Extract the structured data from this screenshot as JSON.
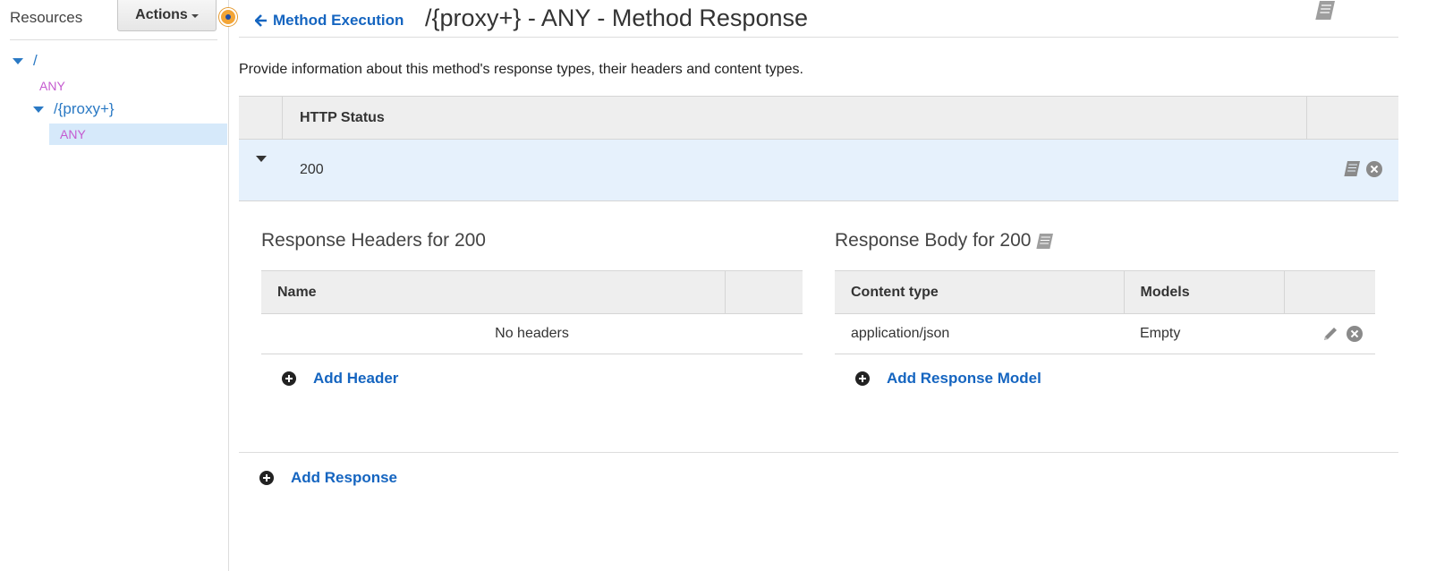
{
  "sidebar": {
    "title": "Resources",
    "actions_label": "Actions",
    "tree": [
      {
        "path": "/",
        "method": "ANY"
      },
      {
        "path": "/{proxy+}",
        "method": "ANY",
        "selected": true
      }
    ]
  },
  "header": {
    "back_label": "Method Execution",
    "title": "/{proxy+} - ANY - Method Response"
  },
  "description": "Provide information about this method's response types, their headers and content types.",
  "status_table": {
    "column_header": "HTTP Status",
    "rows": [
      {
        "code": "200"
      }
    ]
  },
  "response_headers": {
    "title": "Response Headers for 200",
    "columns": [
      "Name",
      ""
    ],
    "empty_text": "No headers",
    "add_label": "Add Header"
  },
  "response_body": {
    "title": "Response Body for 200",
    "columns": [
      "Content type",
      "Models",
      ""
    ],
    "rows": [
      {
        "content_type": "application/json",
        "model": "Empty"
      }
    ],
    "add_label": "Add Response Model"
  },
  "add_response_label": "Add Response",
  "colors": {
    "link": "#1565c0",
    "method": "#c55bd0",
    "selection": "#d6e9fa",
    "handle": "#f3a536"
  }
}
